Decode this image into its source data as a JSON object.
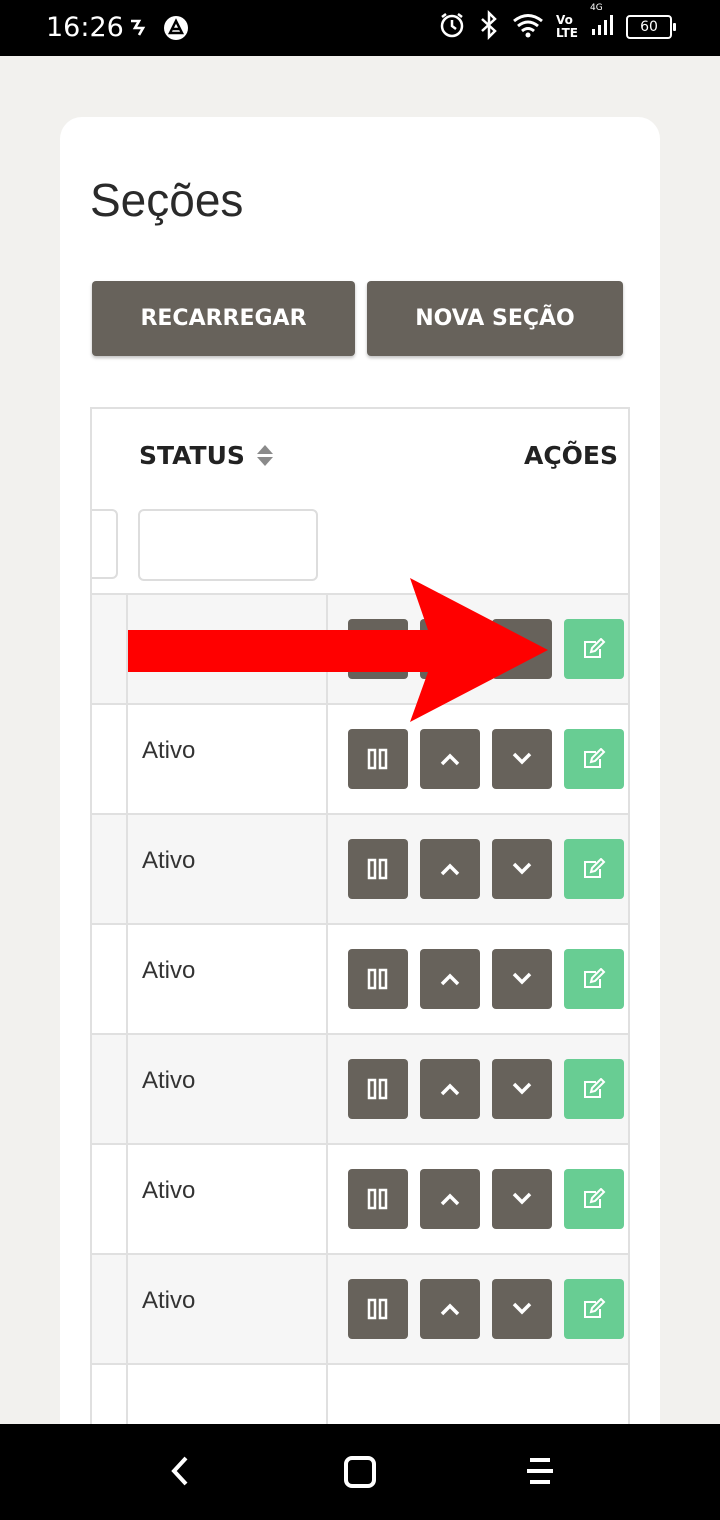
{
  "status_bar": {
    "time": "16:26",
    "network_top": "Vo",
    "network_bottom": "LTE",
    "network_gen": "4G",
    "battery": "60"
  },
  "page": {
    "title": "Seções",
    "reload_label": "RECARREGAR",
    "new_section_label": "NOVA SEÇÃO"
  },
  "table": {
    "header_status": "STATUS",
    "header_actions": "AÇÕES",
    "rows": [
      {
        "status": ""
      },
      {
        "status": "Ativo"
      },
      {
        "status": "Ativo"
      },
      {
        "status": "Ativo"
      },
      {
        "status": "Ativo"
      },
      {
        "status": "Ativo"
      },
      {
        "status": "Ativo"
      },
      {
        "status": ""
      }
    ]
  },
  "colors": {
    "button_dark": "#67625b",
    "button_edit": "#68cd93",
    "arrow": "#ff0000",
    "page_bg": "#f2f1ee"
  },
  "icons": {
    "pause": "pause-icon",
    "up": "chevron-up-icon",
    "down": "chevron-down-icon",
    "edit": "edit-icon"
  }
}
